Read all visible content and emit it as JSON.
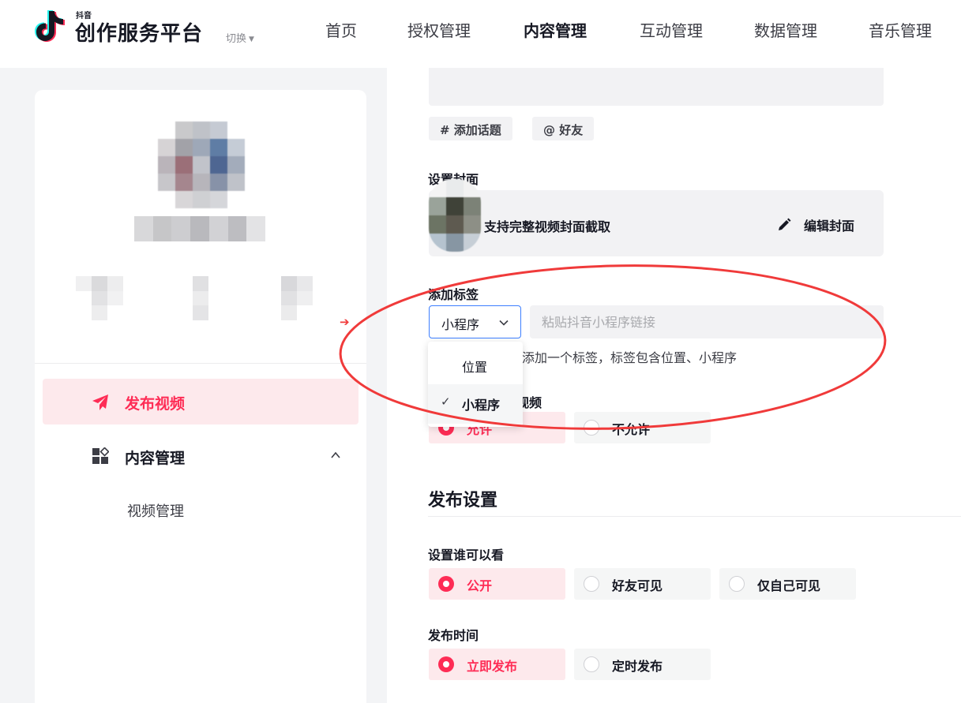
{
  "header": {
    "logo_small": "抖音",
    "logo_title": "创作服务平台",
    "switch_label": "切换",
    "nav": [
      {
        "label": "首页",
        "active": false
      },
      {
        "label": "授权管理",
        "active": false
      },
      {
        "label": "内容管理",
        "active": true
      },
      {
        "label": "互动管理",
        "active": false
      },
      {
        "label": "数据管理",
        "active": false
      },
      {
        "label": "音乐管理",
        "active": false
      }
    ]
  },
  "sidebar": {
    "menu": {
      "publish": "发布视频",
      "content": "内容管理",
      "video_manage": "视频管理"
    }
  },
  "main": {
    "chips": {
      "topic": "# 添加话题",
      "friend": "@ 好友"
    },
    "cover": {
      "label": "设置封面",
      "text": "支持完整视频封面截取",
      "edit": "编辑封面"
    },
    "tag": {
      "label": "添加标签",
      "selected": "小程序",
      "placeholder": "粘贴抖音小程序链接",
      "hint": "持添加一个标签，标签包含位置、小程序",
      "options": [
        "位置",
        "小程序"
      ],
      "check": "✓"
    },
    "allow": {
      "label_fragment": "视频",
      "options": [
        "允许",
        "不允许"
      ]
    },
    "publish_settings": {
      "title": "发布设置",
      "visibility": {
        "label": "设置谁可以看",
        "options": [
          "公开",
          "好友可见",
          "仅自己可见"
        ]
      },
      "time": {
        "label": "发布时间",
        "options": [
          "立即发布",
          "定时发布"
        ]
      }
    }
  },
  "colors": {
    "brand_red": "#fe2c55",
    "annotation_red": "#f03a3a",
    "select_border": "#3d7fff"
  }
}
